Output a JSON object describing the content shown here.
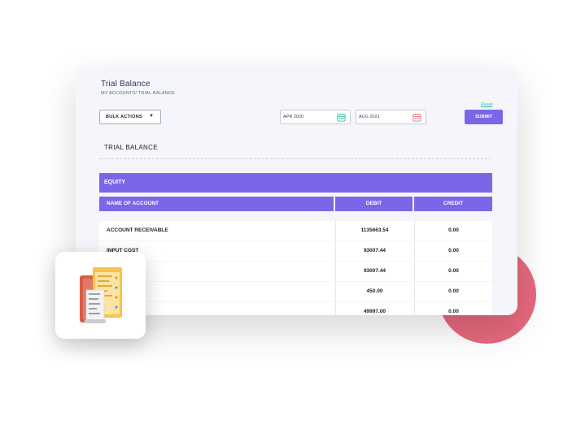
{
  "header": {
    "title": "Trial Balance",
    "breadcrumb": "MY ACCOUNTS/ TRIAL BALANCE"
  },
  "toolbar": {
    "bulk_actions_label": "BULK ACTIONS",
    "from_date": "APR 2020",
    "to_date": "AUG 2021",
    "reset_label": "Reset",
    "submit_label": "SUBMIT"
  },
  "section_title": "TRIAL BALANCE",
  "group_label": "EQUITY",
  "table": {
    "columns": [
      "NAME OF ACCOUNT",
      "DEBIT",
      "CREDIT"
    ],
    "rows": [
      {
        "name": "ACCOUNT RECEIVABLE",
        "debit": "1135663.54",
        "credit": "0.00"
      },
      {
        "name": "INPUT CGST",
        "debit": "93007.44",
        "credit": "0.00"
      },
      {
        "name": "",
        "debit": "93007.44",
        "credit": "0.00"
      },
      {
        "name": "",
        "debit": "450.00",
        "credit": "0.00"
      },
      {
        "name": "",
        "debit": "49997.00",
        "credit": "0.00"
      }
    ]
  },
  "icons": {
    "calendar_from": "calendar-icon",
    "calendar_to": "calendar-icon",
    "dropdown": "chevron-down-icon",
    "app_icon": "document-receipt-icon"
  },
  "colors": {
    "accent": "#7c66e8",
    "reset_link": "#2bbfa4",
    "decor_circle": "#e6697e",
    "calendar_from": "#2bbfa4",
    "calendar_to": "#e6697e"
  }
}
